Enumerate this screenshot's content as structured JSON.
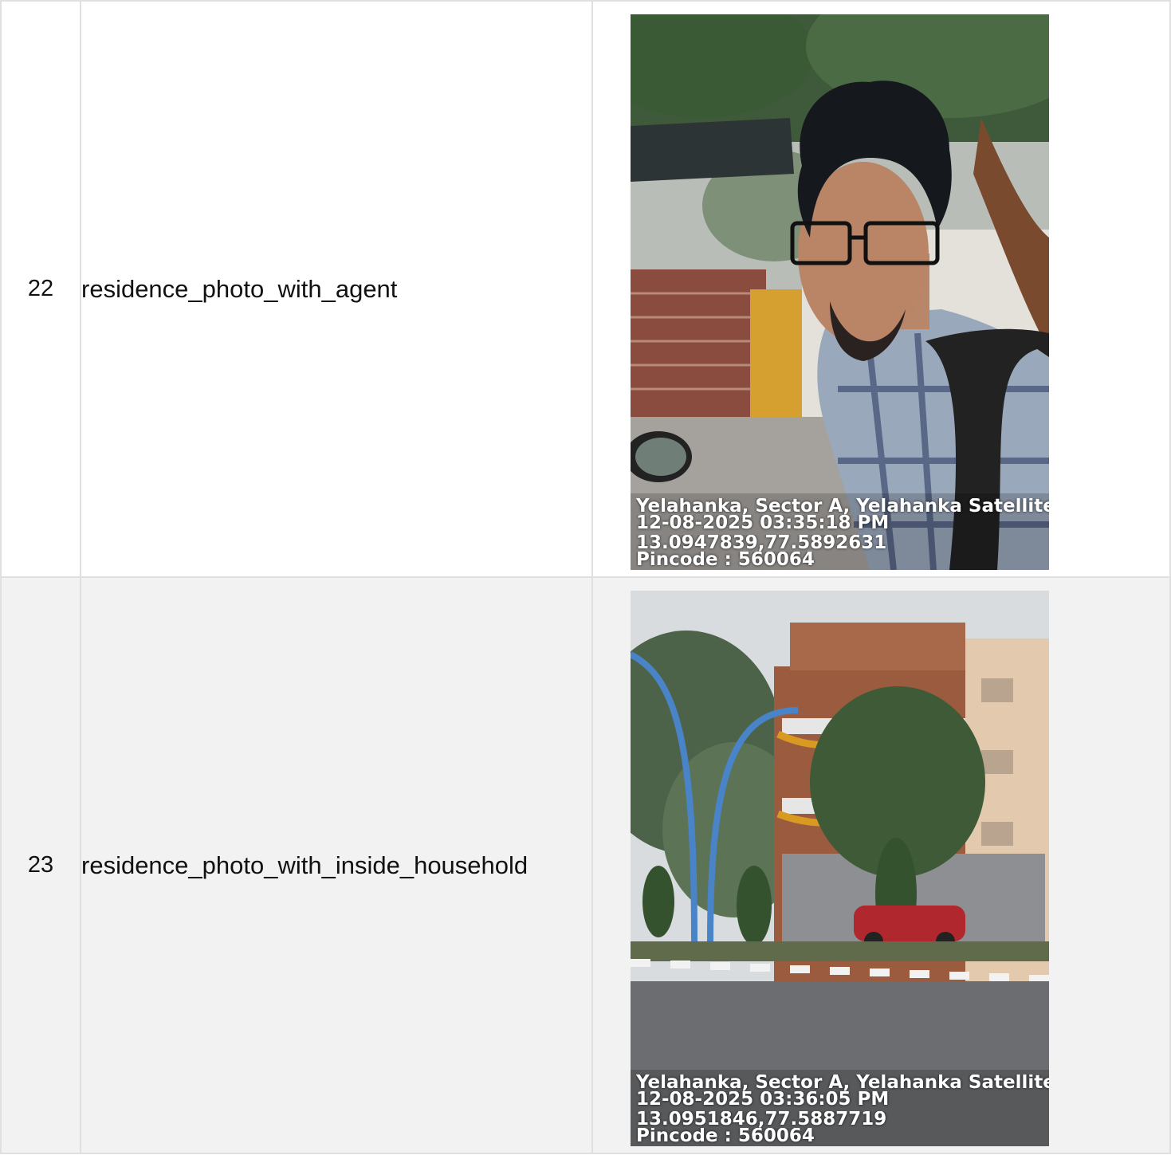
{
  "rows": [
    {
      "index": "22",
      "field": "residence_photo_with_agent",
      "photo": {
        "icon": "selfie-photo",
        "location": "Yelahanka, Sector A, Yelahanka Satellite Tow",
        "datetime": "12-08-2025 03:35:18 PM",
        "coords": "13.0947839,77.5892631",
        "pincode": "Pincode : 560064"
      }
    },
    {
      "index": "23",
      "field": "residence_photo_with_inside_household",
      "photo": {
        "icon": "building-photo",
        "location": "Yelahanka, Sector A, Yelahanka Satellite Tow",
        "datetime": "12-08-2025 03:36:05 PM",
        "coords": "13.0951846,77.5887719",
        "pincode": "Pincode : 560064"
      }
    }
  ]
}
